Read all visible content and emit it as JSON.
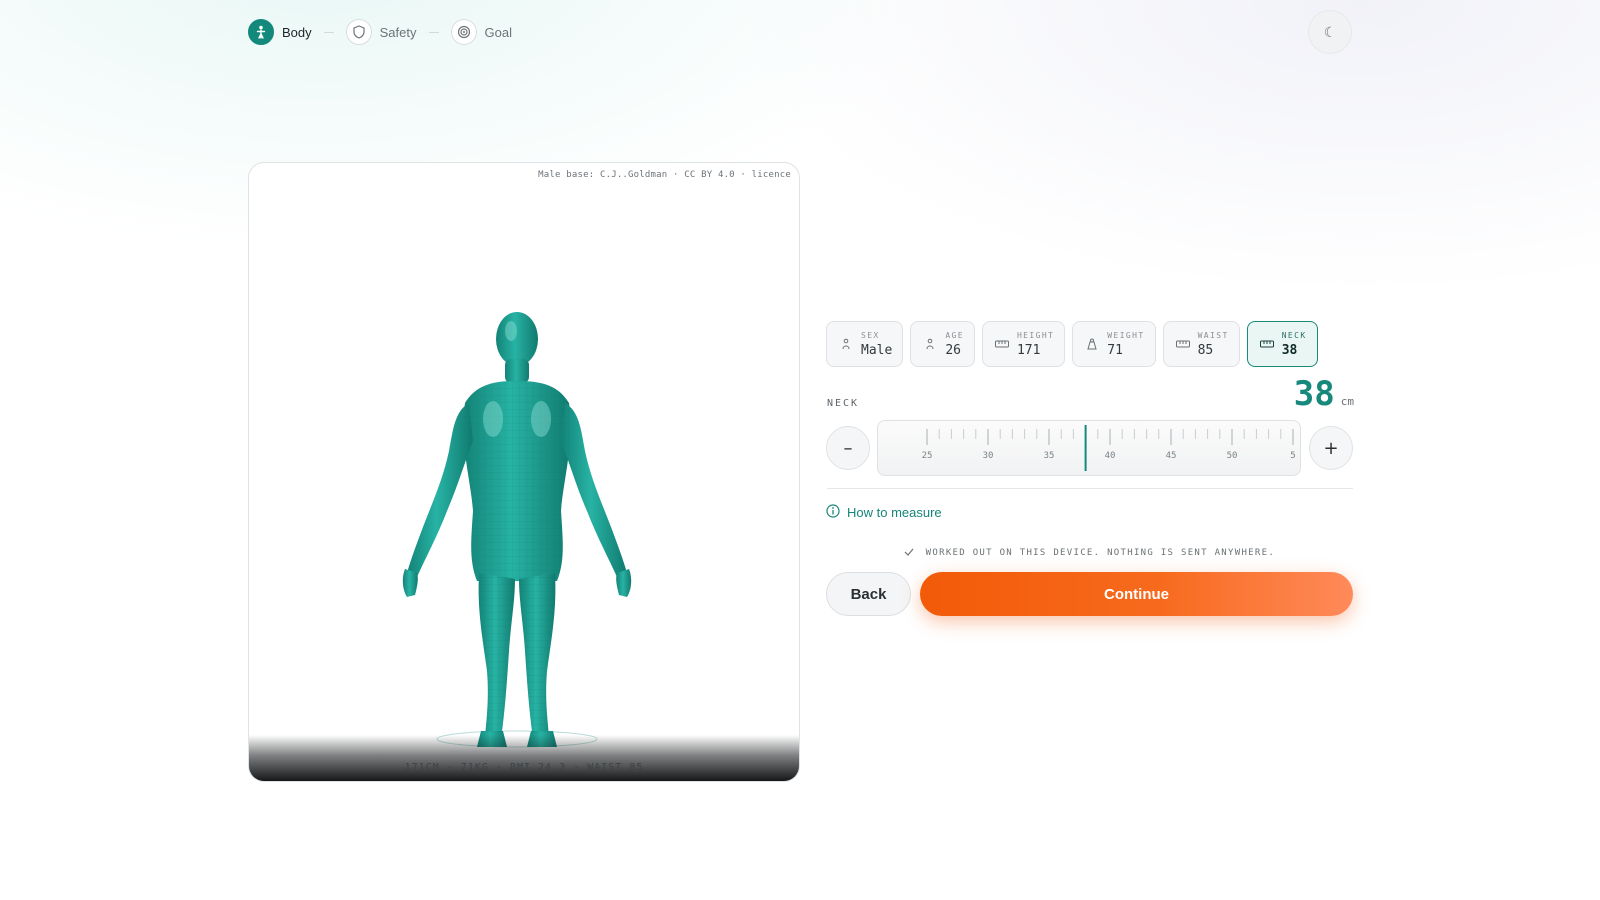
{
  "stepper": {
    "steps": [
      {
        "label": "Body",
        "icon": "person-icon",
        "active": true
      },
      {
        "label": "Safety",
        "icon": "shield-icon",
        "active": false
      },
      {
        "label": "Goal",
        "icon": "target-icon",
        "active": false
      }
    ]
  },
  "theme_toggle": {
    "icon": "moon-icon",
    "glyph": "☾"
  },
  "viewer": {
    "credit": "Male base: C.J..Goldman · CC BY 4.0 · licence",
    "stats": "171CM · 71KG · BMI 24.3 · WAIST 85"
  },
  "chips": [
    {
      "label": "SEX",
      "value": "Male",
      "icon": "person-icon"
    },
    {
      "label": "AGE",
      "value": "26",
      "icon": "person-icon"
    },
    {
      "label": "HEIGHT",
      "value": "171",
      "icon": "ruler-icon"
    },
    {
      "label": "WEIGHT",
      "value": "71",
      "icon": "weight-icon"
    },
    {
      "label": "WAIST",
      "value": "85",
      "icon": "tape-icon"
    },
    {
      "label": "NECK",
      "value": "38",
      "icon": "tape-icon"
    }
  ],
  "measure": {
    "label": "NECK",
    "value": "38",
    "unit": "cm",
    "ruler_ticks": [
      "25",
      "30",
      "35",
      "40",
      "45",
      "50",
      "5"
    ],
    "current": 38,
    "decrement": "–",
    "increment": "+"
  },
  "howto": {
    "label": "How to measure",
    "icon": "info-icon"
  },
  "privacy": "WORKED OUT ON THIS DEVICE. NOTHING IS SENT ANYWHERE.",
  "actions": {
    "back": "Back",
    "continue": "Continue"
  },
  "colors": {
    "accent": "#16897c",
    "cta": "#f25a08",
    "body": "#1aa396"
  }
}
